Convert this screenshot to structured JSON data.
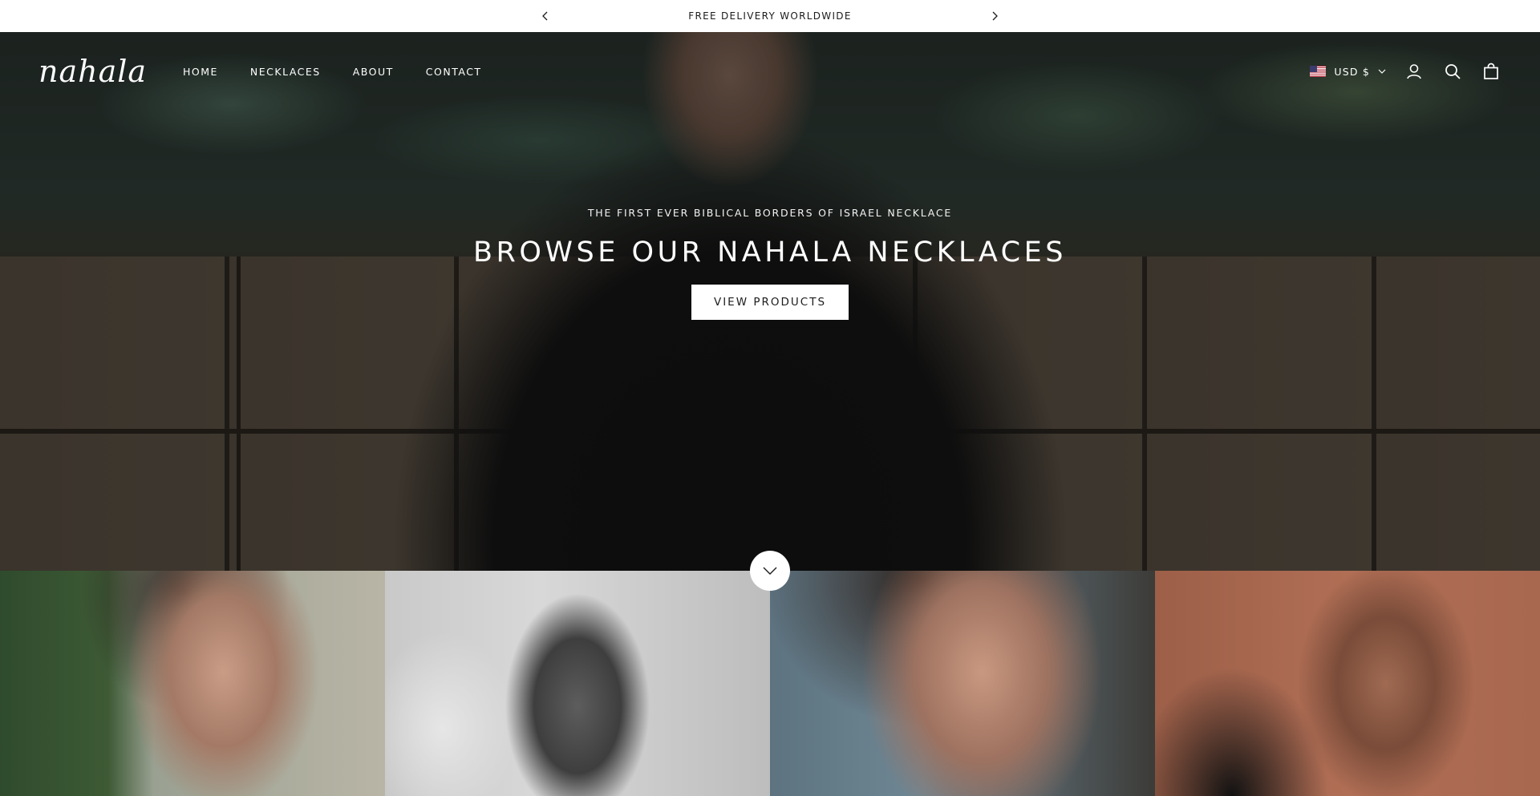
{
  "announcement": {
    "text": "FREE DELIVERY WORLDWIDE",
    "prev_icon": "chevron-left-icon",
    "next_icon": "chevron-right-icon"
  },
  "header": {
    "logo_text": "nahala",
    "nav": [
      {
        "label": "HOME"
      },
      {
        "label": "NECKLACES"
      },
      {
        "label": "ABOUT"
      },
      {
        "label": "CONTACT"
      }
    ],
    "currency": "USD $",
    "icons": [
      "account-icon",
      "search-icon",
      "cart-icon"
    ]
  },
  "hero": {
    "subheading": "THE FIRST EVER BIBLICAL BORDERS OF ISRAEL NECKLACE",
    "title": "BROWSE OUR NAHALA NECKLACES",
    "button_label": "VIEW PRODUCTS"
  },
  "colors": {
    "announcement_bg": "#ffffff",
    "button_bg": "#ffffff",
    "text_dark": "#1c1c1c"
  }
}
